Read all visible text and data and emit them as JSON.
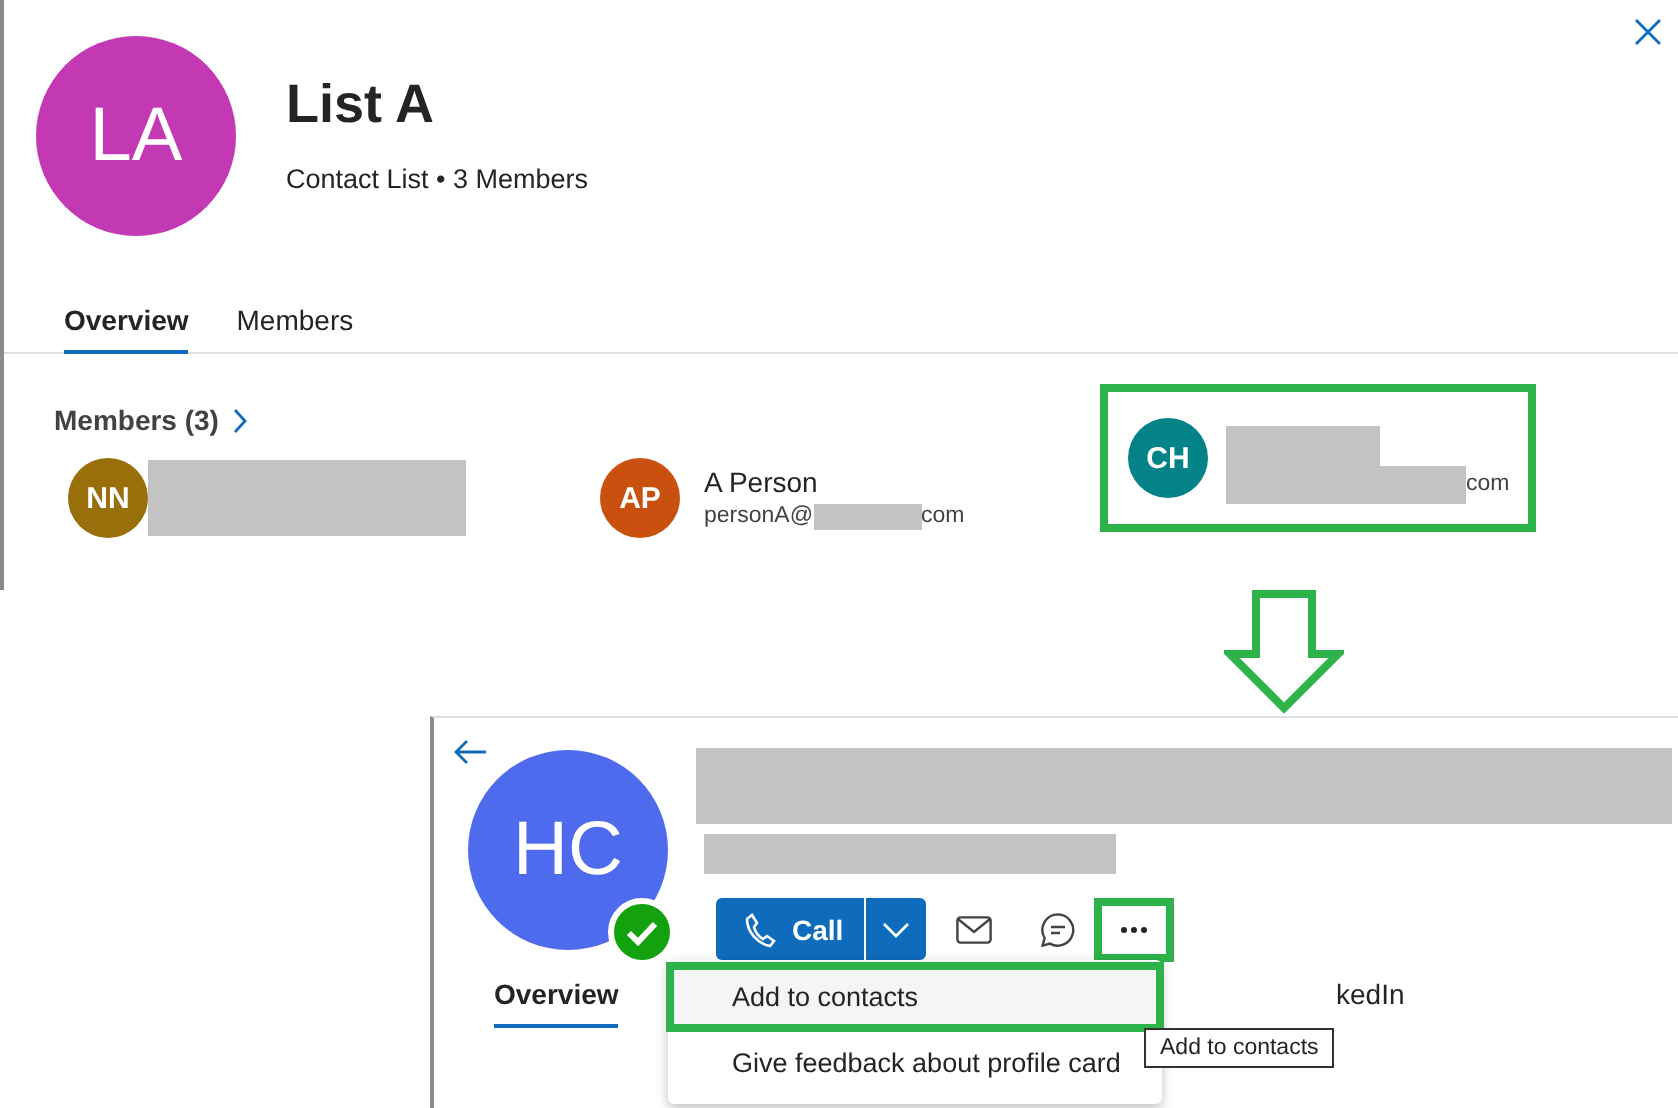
{
  "list_card": {
    "avatar": {
      "initials": "LA",
      "color": "#c239b3"
    },
    "title": "List A",
    "subtitle": "Contact List • 3 Members",
    "tabs": [
      {
        "label": "Overview",
        "selected": true
      },
      {
        "label": "Members",
        "selected": false
      }
    ],
    "members_heading": "Members (3)",
    "members": [
      {
        "initials": "NN",
        "color": "#986f0b",
        "name_redacted": true
      },
      {
        "initials": "AP",
        "color": "#ca5010",
        "name": "A Person",
        "email_start": "personA@",
        "email_end": "com",
        "email_redacted": true
      },
      {
        "initials": "CH",
        "color": "#038387",
        "email_end": "com",
        "name_redacted": true,
        "email_redacted": true,
        "highlighted": true
      }
    ]
  },
  "profile_card": {
    "avatar": {
      "initials": "HC",
      "color": "#4f6bed"
    },
    "available": true,
    "redacted": true,
    "call_label": "Call",
    "more_highlighted": true,
    "menu": [
      {
        "label": "Add to contacts",
        "highlighted": true
      },
      {
        "label": "Give feedback about profile card",
        "highlighted": false
      }
    ],
    "tabs": [
      {
        "label": "Overview",
        "selected": true
      },
      {
        "label": "kedIn",
        "selected": false
      }
    ],
    "tooltip": "Add to contacts"
  }
}
